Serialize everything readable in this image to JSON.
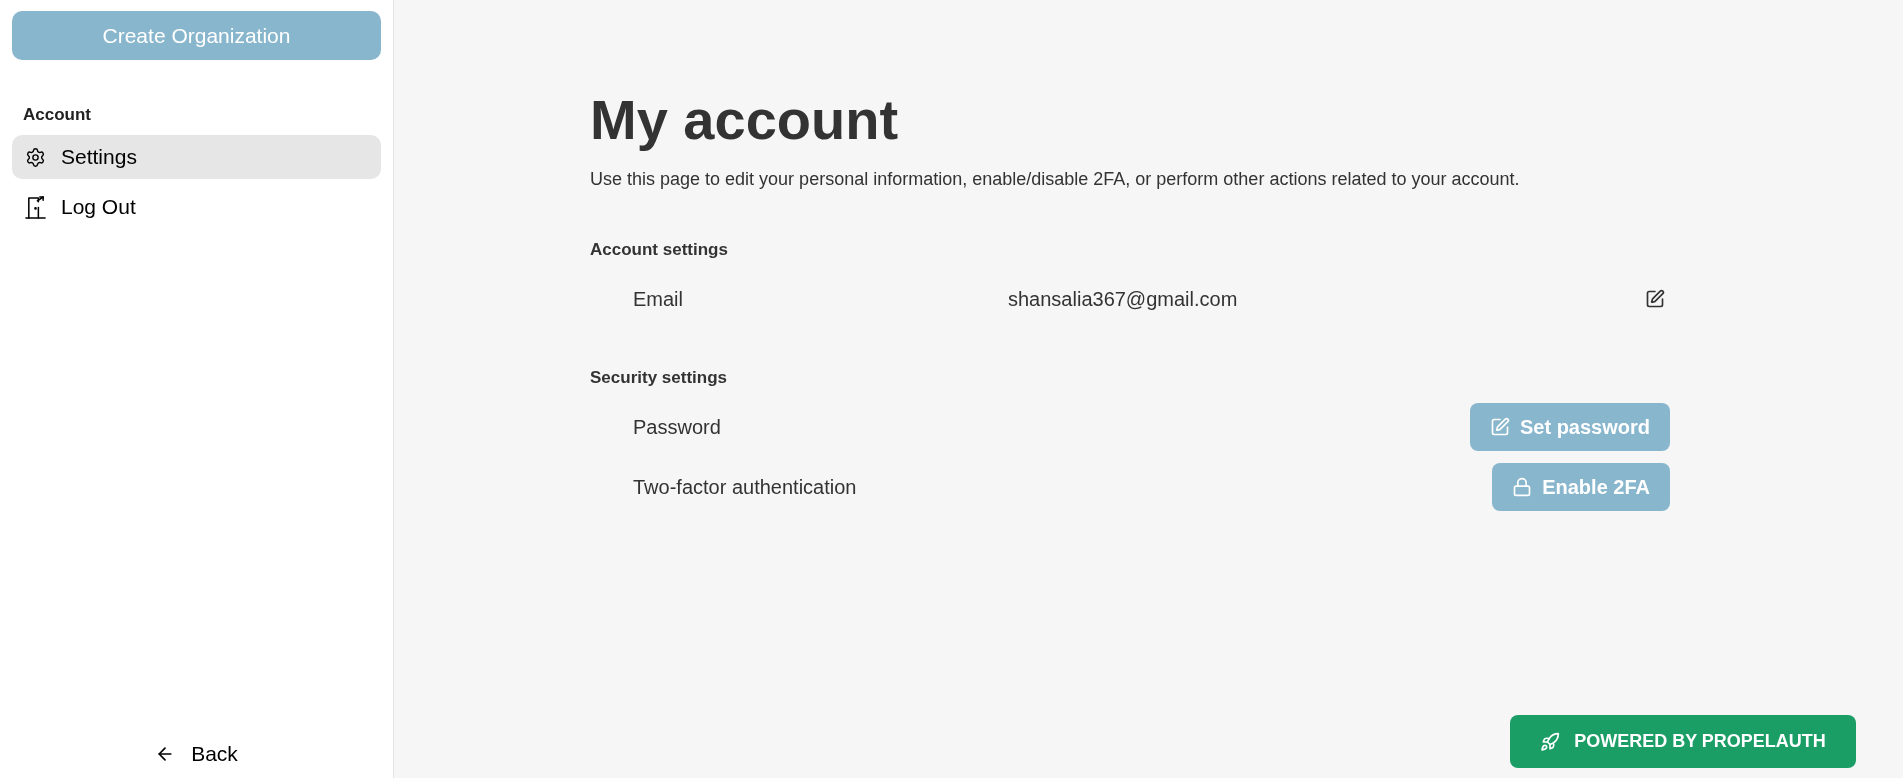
{
  "sidebar": {
    "create_button": "Create Organization",
    "section_label": "Account",
    "items": [
      {
        "label": "Settings",
        "kind": "settings",
        "selected": true
      },
      {
        "label": "Log Out",
        "kind": "logout",
        "selected": false
      }
    ],
    "back_link": "Back"
  },
  "main": {
    "title": "My account",
    "description": "Use this page to edit your personal information, enable/disable 2FA, or perform other actions related to your account.",
    "sections": [
      {
        "title": "Account settings",
        "rows": [
          {
            "label": "Email",
            "kind": "value",
            "value": "shansalia367@gmail.com"
          }
        ]
      },
      {
        "title": "Security settings",
        "rows": [
          {
            "label": "Password",
            "kind": "action",
            "button": {
              "label": "Set password",
              "kind": "edit"
            }
          },
          {
            "label": "Two-factor authentication",
            "kind": "action",
            "button": {
              "label": "Enable 2FA",
              "kind": "lock"
            }
          }
        ]
      }
    ]
  },
  "badge": {
    "label": "POWERED BY PROPELAUTH"
  }
}
